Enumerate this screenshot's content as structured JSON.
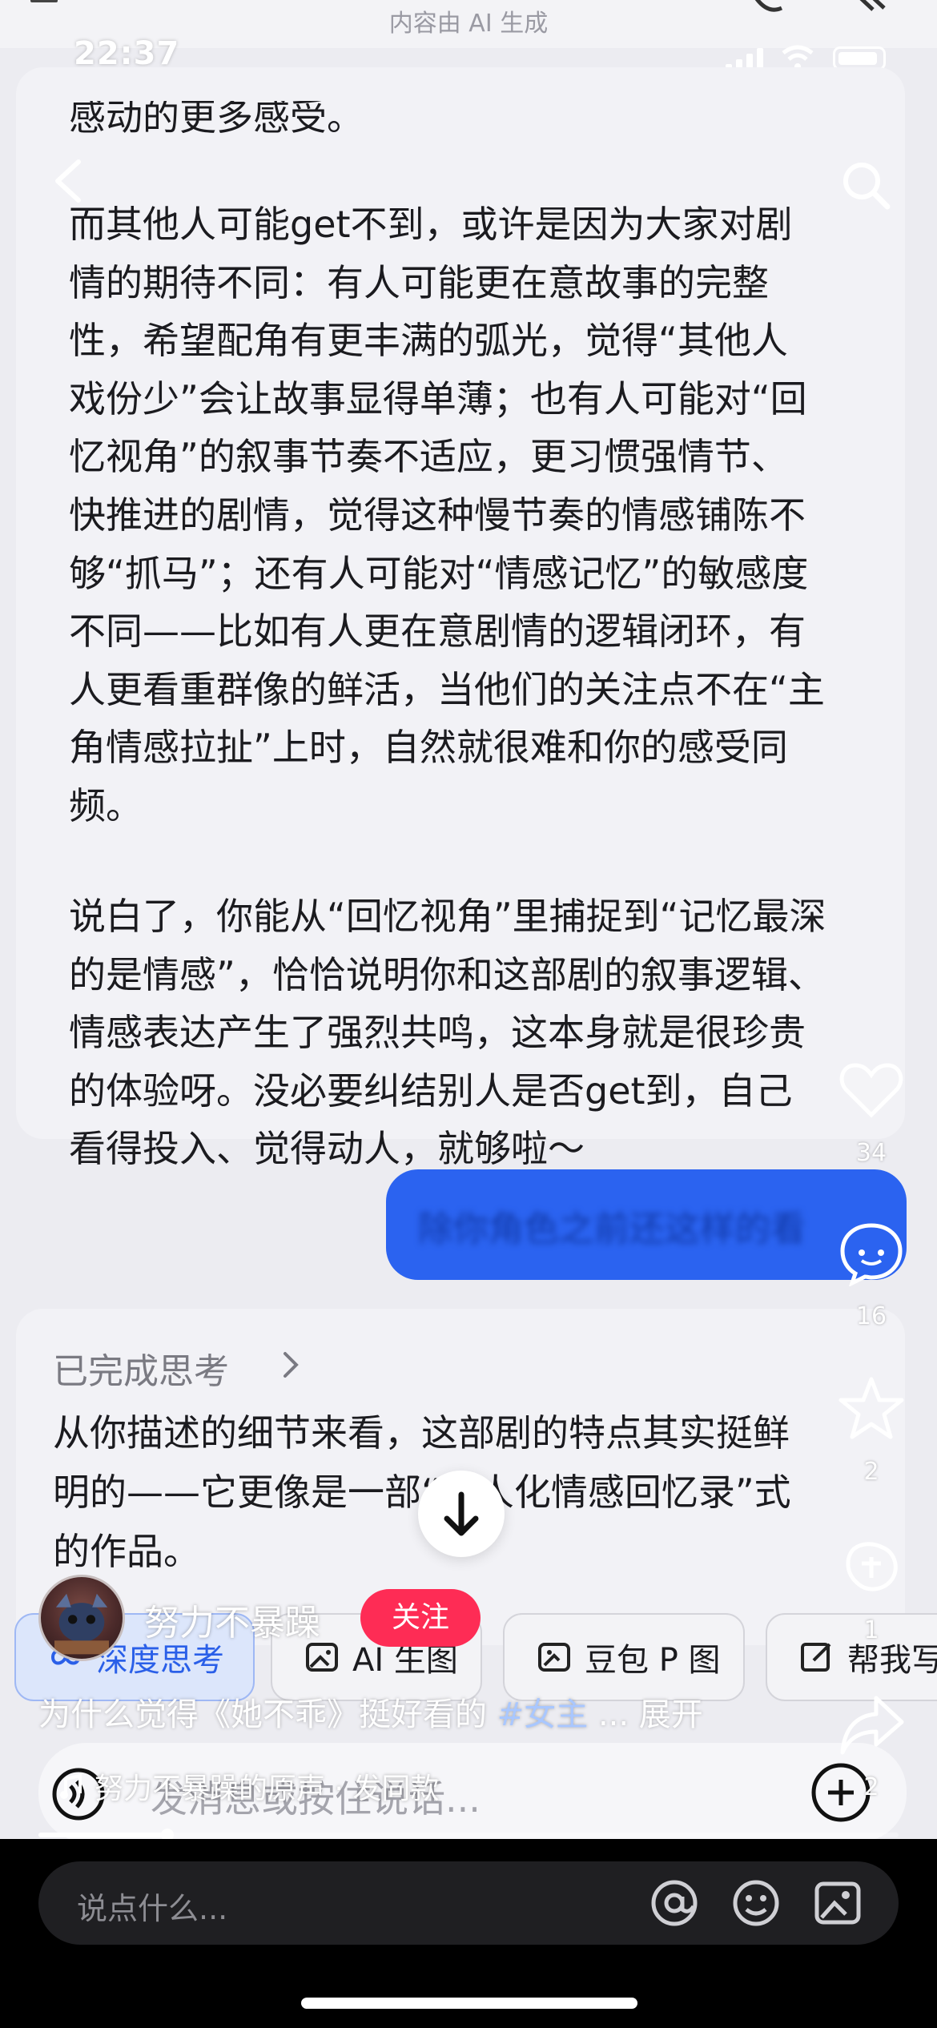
{
  "top": {
    "ai_note": "内容由 AI 生成",
    "status_time": "22:37"
  },
  "answer_bubble": {
    "cut_line": "感动的更多感受。",
    "para_1": "而其他人可能get不到，或许是因为大家对剧\n情的期待不同：有人可能更在意故事的完整\n性，希望配角有更丰满的弧光，觉得“其他人\n戏份少”会让故事显得单薄；也有人可能对“回\n忆视角”的叙事节奏不适应，更习惯强情节、\n快推进的剧情，觉得这种慢节奏的情感铺陈不\n够“抓马”；还有人可能对“情感记忆”的敏感度\n不同——比如有人更在意剧情的逻辑闭环，有\n人更看重群像的鲜活，当他们的关注点不在“主\n角情感拉扯”上时，自然就很难和你的感受同\n频。",
    "para_2": "说白了，你能从“回忆视角”里捕捉到“记忆最深\n的是情感”，恰恰说明你和这部剧的叙事逻辑、\n情感表达产生了强烈共鸣，这本身就是很珍贵\n的体验呀。没必要纠结别人是否get到，自己\n看得投入、觉得动人，就够啦～"
  },
  "user_message": {
    "text": "除你角色之前还这样的看"
  },
  "thinking_card": {
    "status": "已完成思考",
    "answer": "从你描述的细节来看，这部剧的特点其实挺鲜\n明的——它更像是一部“人人化情感回忆录”式\n的作品。"
  },
  "chips": [
    {
      "label": "深度思考",
      "icon": "infinity-icon"
    },
    {
      "label": "AI 生图",
      "icon": "image-icon"
    },
    {
      "label": "豆包 P 图",
      "icon": "image-edit-icon"
    },
    {
      "label": "帮我写",
      "icon": "pencil-icon"
    }
  ],
  "chat_input": {
    "placeholder": "发消息或按住说话..."
  },
  "rail": {
    "like_count": "34",
    "comment_count": "16",
    "favorite_count": "2",
    "gift_count": "1",
    "share_count": "2"
  },
  "author": {
    "name": "努力不暴躁",
    "follow_label": "关注"
  },
  "caption": {
    "text": "为什么觉得《她不乖》挺好看的 ",
    "hashtag": "#女主",
    "more": " ... 展开"
  },
  "music": {
    "text": "努力不暴躁的原声 · 发同款"
  },
  "progress": {
    "fraction": 0.15
  },
  "comment_bar": {
    "placeholder": "说点什么..."
  },
  "colors": {
    "user_bubble": "#2b63f0",
    "follow": "#fe2c55",
    "deep_think_chip": "#dce6fb"
  }
}
